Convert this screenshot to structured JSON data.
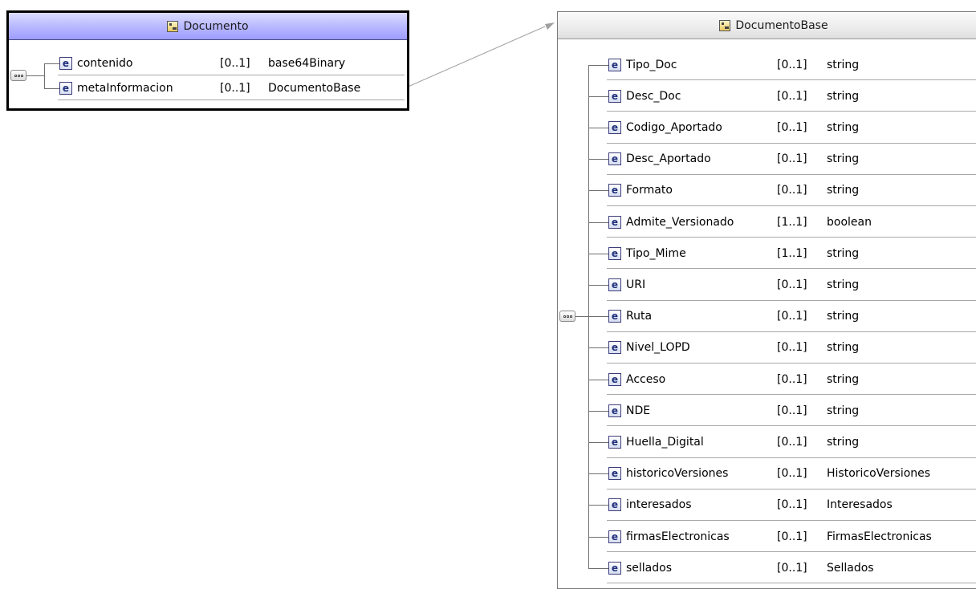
{
  "documento": {
    "title": "Documento",
    "rows": [
      {
        "name": "contenido",
        "card": "[0..1]",
        "type": "base64Binary"
      },
      {
        "name": "metaInformacion",
        "card": "[0..1]",
        "type": "DocumentoBase"
      }
    ]
  },
  "documento_base": {
    "title": "DocumentoBase",
    "rows": [
      {
        "name": "Tipo_Doc",
        "card": "[0..1]",
        "type": "string"
      },
      {
        "name": "Desc_Doc",
        "card": "[0..1]",
        "type": "string"
      },
      {
        "name": "Codigo_Aportado",
        "card": "[0..1]",
        "type": "string"
      },
      {
        "name": "Desc_Aportado",
        "card": "[0..1]",
        "type": "string"
      },
      {
        "name": "Formato",
        "card": "[0..1]",
        "type": "string"
      },
      {
        "name": "Admite_Versionado",
        "card": "[1..1]",
        "type": "boolean"
      },
      {
        "name": "Tipo_Mime",
        "card": "[1..1]",
        "type": "string"
      },
      {
        "name": "URI",
        "card": "[0..1]",
        "type": "string"
      },
      {
        "name": "Ruta",
        "card": "[0..1]",
        "type": "string"
      },
      {
        "name": "Nivel_LOPD",
        "card": "[0..1]",
        "type": "string"
      },
      {
        "name": "Acceso",
        "card": "[0..1]",
        "type": "string"
      },
      {
        "name": "NDE",
        "card": "[0..1]",
        "type": "string"
      },
      {
        "name": "Huella_Digital",
        "card": "[0..1]",
        "type": "string"
      },
      {
        "name": "historicoVersiones",
        "card": "[0..1]",
        "type": "HistoricoVersiones"
      },
      {
        "name": "interesados",
        "card": "[0..1]",
        "type": "Interesados"
      },
      {
        "name": "firmasElectronicas",
        "card": "[0..1]",
        "type": "FirmasElectronicas"
      },
      {
        "name": "sellados",
        "card": "[0..1]",
        "type": "Sellados"
      }
    ]
  },
  "icons": {
    "complex_type": "complex-type-icon",
    "element": "element-icon",
    "sequence": "sequence-icon"
  },
  "element_icon_letter": "e"
}
